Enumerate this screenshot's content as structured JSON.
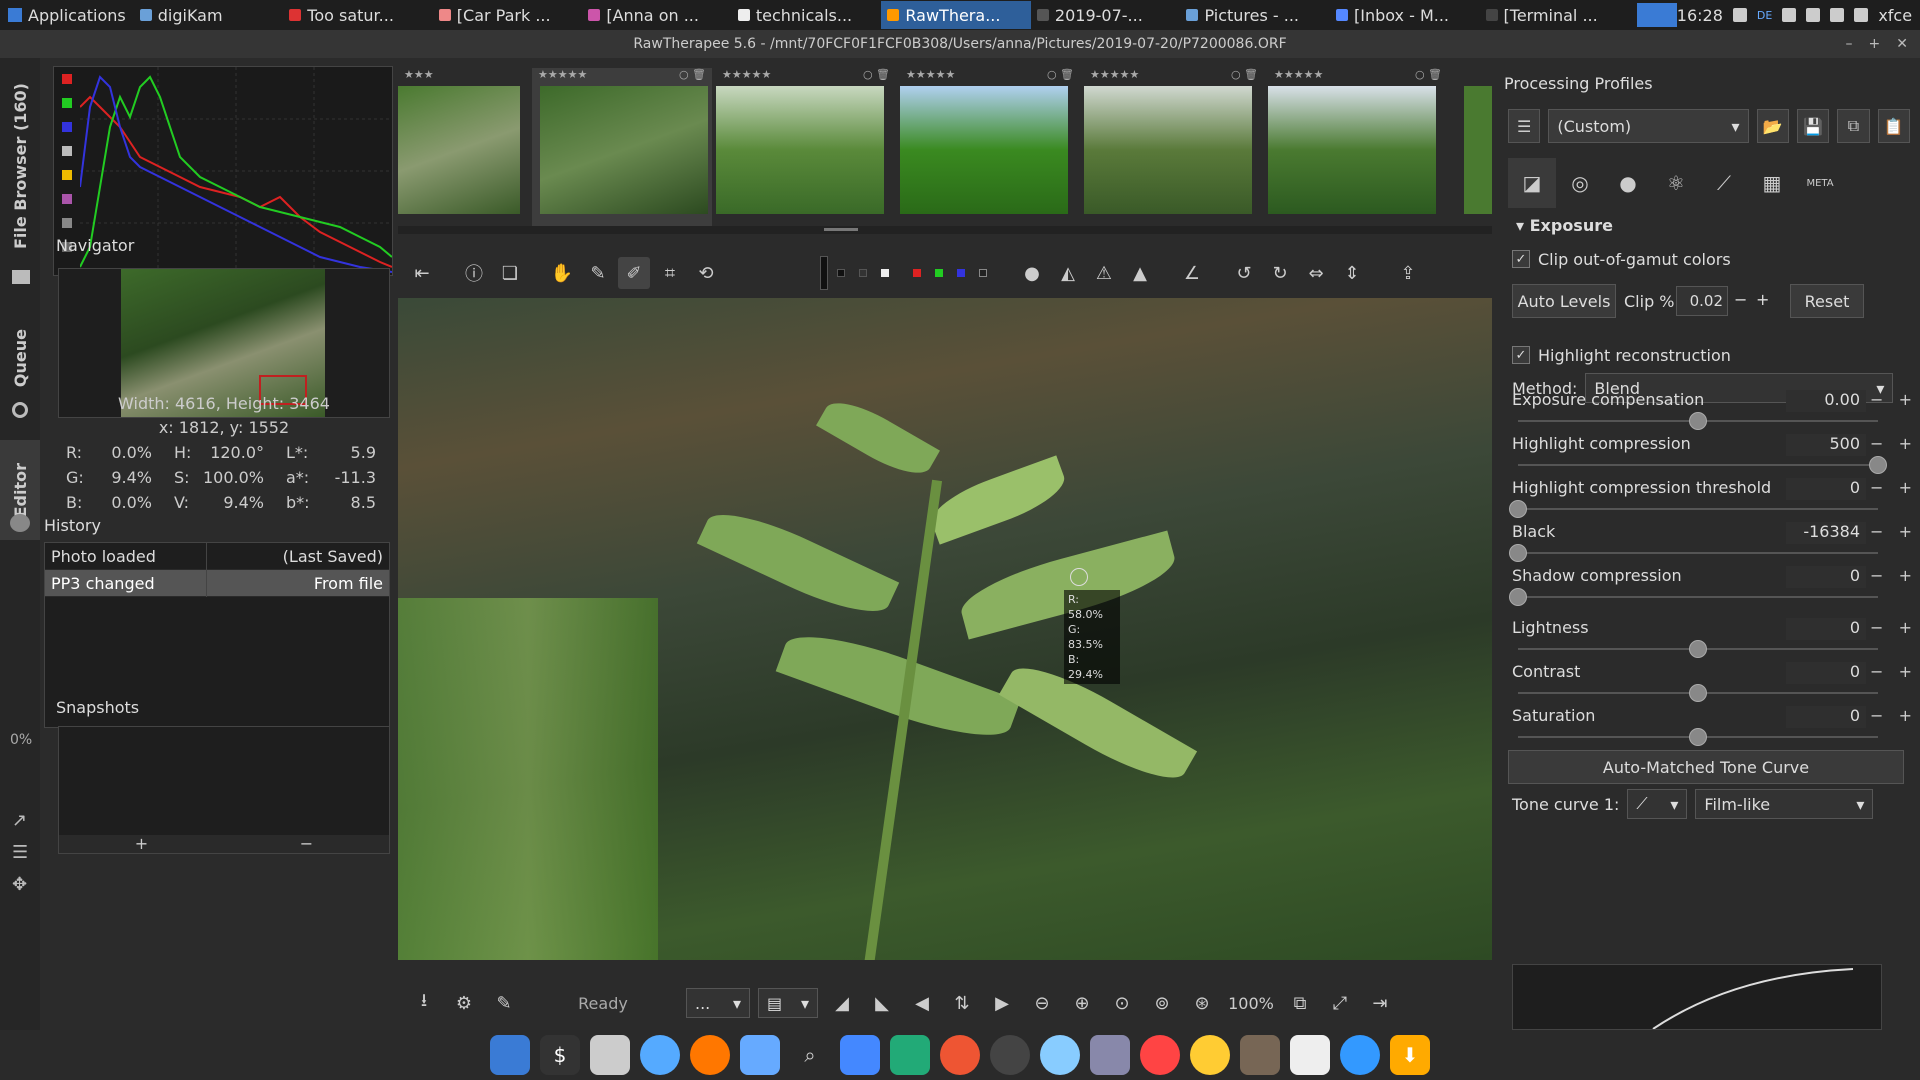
{
  "taskbar": {
    "apps_label": "Applications",
    "tasks": [
      {
        "label": "digiKam"
      },
      {
        "label": "Too satur..."
      },
      {
        "label": "[Car Park ..."
      },
      {
        "label": "[Anna on ..."
      },
      {
        "label": "technicals..."
      },
      {
        "label": "RawThera..."
      },
      {
        "label": "2019-07-..."
      },
      {
        "label": "Pictures - ..."
      },
      {
        "label": "[Inbox - M..."
      },
      {
        "label": "[Terminal ..."
      }
    ],
    "clock": "16:28",
    "keyboard_layout": "DE",
    "user": "xfce"
  },
  "window": {
    "title": "RawTherapee 5.6 - /mnt/70FCF0F1FCF0B308/Users/anna/Pictures/2019-07-20/P7200086.ORF"
  },
  "side_tabs": {
    "file_browser": "File Browser (160)",
    "queue": "Queue",
    "editor": "Editor",
    "progress": "0%"
  },
  "left": {
    "navigator_title": "Navigator",
    "dimensions": "Width: 4616, Height: 3464",
    "coords": "x: 1812, y: 1552",
    "info": {
      "r_label": "R:",
      "r": "0.0%",
      "h_label": "H:",
      "h": "120.0°",
      "l_label": "L*:",
      "l": "5.9",
      "g_label": "G:",
      "g": "9.4%",
      "s_label": "S:",
      "s": "100.0%",
      "a_label": "a*:",
      "a": "-11.3",
      "b_label": "B:",
      "b": "0.0%",
      "v_label": "V:",
      "v": "9.4%",
      "bs_label": "b*:",
      "bs": "8.5"
    },
    "history_title": "History",
    "history": [
      {
        "action": "Photo loaded",
        "detail": "(Last Saved)"
      },
      {
        "action": "PP3 changed",
        "detail": "From file"
      }
    ],
    "snapshots_title": "Snapshots",
    "snap_add": "+",
    "snap_remove": "−"
  },
  "picker": {
    "r": "R: 58.0%",
    "g": "G: 83.5%",
    "b": "B: 29.4%"
  },
  "bottom": {
    "status": "Ready",
    "combo": "...",
    "zoom": "100%"
  },
  "right": {
    "profiles_title": "Processing Profiles",
    "profile_value": "(Custom)",
    "exposure_title": "Exposure",
    "clip_oog": "Clip out-of-gamut colors",
    "auto_levels": "Auto Levels",
    "clip_label": "Clip %",
    "clip_value": "0.02",
    "reset": "Reset",
    "highlight_recon": "Highlight reconstruction",
    "method_label": "Method:",
    "method_value": "Blend",
    "sliders": [
      {
        "name": "Exposure compensation",
        "value": "0.00",
        "pos": 0.5
      },
      {
        "name": "Highlight compression",
        "value": "500",
        "pos": 1.0
      },
      {
        "name": "Highlight compression threshold",
        "value": "0",
        "pos": 0.0
      },
      {
        "name": "Black",
        "value": "-16384",
        "pos": 0.0
      },
      {
        "name": "Shadow compression",
        "value": "0",
        "pos": 0.0
      },
      {
        "name": "Lightness",
        "value": "0",
        "pos": 0.5
      },
      {
        "name": "Contrast",
        "value": "0",
        "pos": 0.5
      },
      {
        "name": "Saturation",
        "value": "0",
        "pos": 0.5
      }
    ],
    "amtc": "Auto-Matched Tone Curve",
    "tone_curve_label": "Tone curve 1:",
    "tone_curve_value": "Film-like"
  }
}
